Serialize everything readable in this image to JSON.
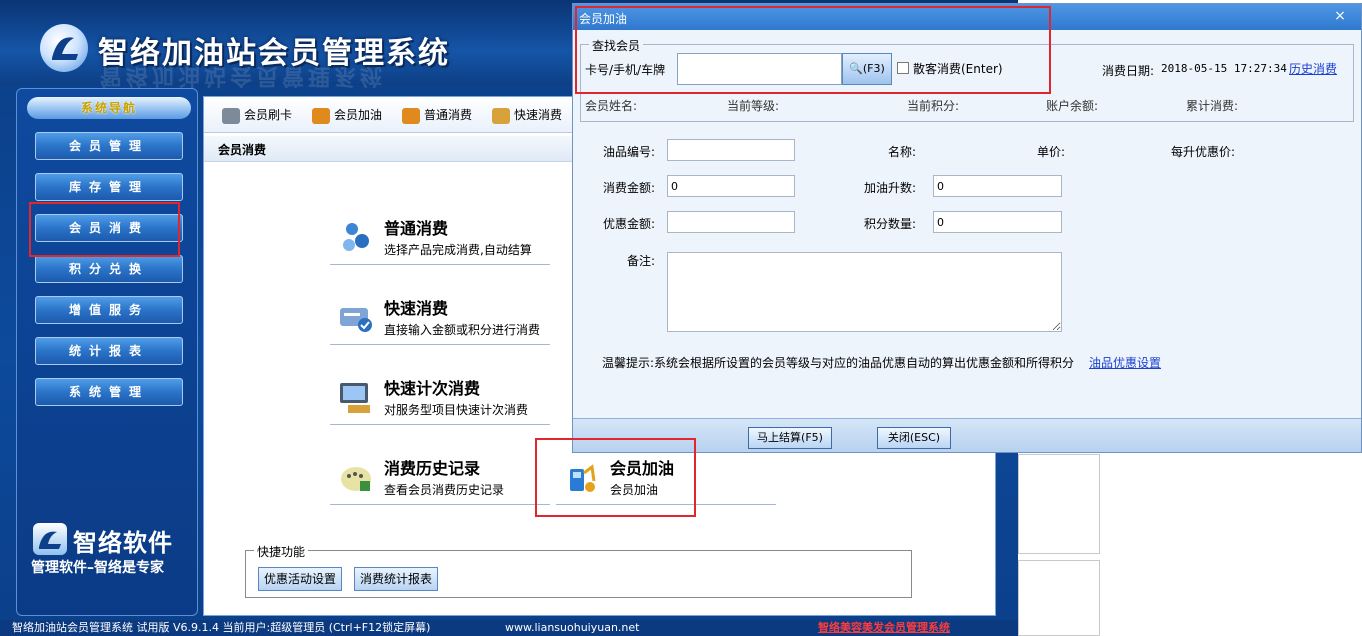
{
  "app": {
    "title": "智络加油站会员管理系统",
    "title_reflection": "智络加油站会员管理系统"
  },
  "sidebar": {
    "title": "系统导航",
    "items": [
      {
        "label": "会员管理"
      },
      {
        "label": "库存管理"
      },
      {
        "label": "会员消费"
      },
      {
        "label": "积分兑换"
      },
      {
        "label": "增值服务"
      },
      {
        "label": "统计报表"
      },
      {
        "label": "系统管理"
      }
    ],
    "brand_name": "智络软件",
    "brand_slogan": "管理软件–智络是专家"
  },
  "toolbar": {
    "items": [
      {
        "label": "会员刷卡",
        "icon": "card-icon"
      },
      {
        "label": "会员加油",
        "icon": "fuel-icon"
      },
      {
        "label": "普通消费",
        "icon": "consume-icon"
      },
      {
        "label": "快速消费",
        "icon": "fast-consume-icon"
      }
    ]
  },
  "section": {
    "title": "会员消费"
  },
  "functions": [
    {
      "title": "普通消费",
      "desc": "选择产品完成消费,自动结算",
      "icon": "people-icon"
    },
    {
      "title": "快速消费",
      "desc": "直接输入金额或积分进行消费",
      "icon": "card-check-icon"
    },
    {
      "title": "快速计次消费",
      "desc": "对服务型项目快速计次消费",
      "icon": "monitor-icon"
    },
    {
      "title": "消费历史记录",
      "desc": "查看会员消费历史记录",
      "icon": "history-icon"
    },
    {
      "title": "会员加油",
      "desc": "会员加油",
      "icon": "fuel-pump-icon"
    }
  ],
  "quick": {
    "legend": "快捷功能",
    "buttons": [
      "优惠活动设置",
      "消费统计报表"
    ]
  },
  "status": {
    "text": "智络加油站会员管理系统 试用版 V6.9.1.4 当前用户:超级管理员 (Ctrl+F12锁定屏幕)",
    "url": "www.liansuohuiyuan.net",
    "link": "智络美容美发会员管理系统"
  },
  "dialog": {
    "title": "会员加油",
    "close": "×",
    "find": {
      "legend": "查找会员",
      "card_label": "卡号/手机/车牌",
      "card_value": "",
      "search_button": "(F3)",
      "walkin_label": "散客消费(Enter)",
      "date_label": "消费日期:",
      "date_value": "2018-05-15 17:27:34",
      "history_link": "历史消费"
    },
    "member_labels": [
      "会员姓名:",
      "当前等级:",
      "当前积分:",
      "账户余额:",
      "累计消费:"
    ],
    "fields": {
      "oil_code_label": "油品编号:",
      "oil_code_value": "",
      "name_label": "名称:",
      "price_label": "单价:",
      "discount_per_liter_label": "每升优惠价:",
      "amount_label": "消费金额:",
      "amount_value": "0",
      "liters_label": "加油升数:",
      "liters_value": "0",
      "discount_label": "优惠金额:",
      "discount_value": "",
      "points_label": "积分数量:",
      "points_value": "0",
      "remark_label": "备注:"
    },
    "tip": "温馨提示:系统会根据所设置的会员等级与对应的油品优惠自动的算出优惠金额和所得积分",
    "tip_link": "油品优惠设置",
    "buttons": {
      "checkout": "马上结算(F5)",
      "close": "关闭(ESC)"
    }
  }
}
